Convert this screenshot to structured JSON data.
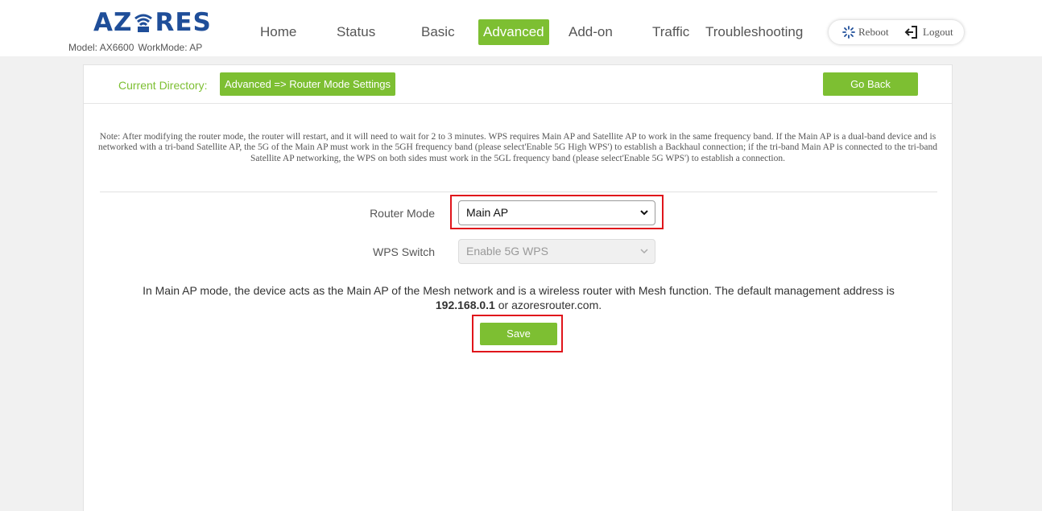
{
  "header": {
    "logo": {
      "part1": "AZ",
      "part2": "RES"
    },
    "model_label": "Model: AX6600",
    "workmode_label": "WorkMode: AP",
    "nav": {
      "home": "Home",
      "status": "Status",
      "basic": "Basic",
      "advanced": "Advanced",
      "addon": "Add-on",
      "traffic": "Traffic",
      "troubleshooting": "Troubleshooting"
    },
    "active_nav": "Advanced",
    "reboot_label": "Reboot",
    "logout_label": "Logout"
  },
  "breadcrumb": {
    "label": "Current Directory:",
    "path": "Advanced => Router Mode Settings",
    "go_back": "Go Back"
  },
  "note": "Note: After modifying the router mode, the router will restart, and it will need to wait for 2 to 3 minutes. WPS requires Main AP and Satellite AP to work in the same frequency band. If the Main AP is a dual-band device and is networked with a tri-band Satellite AP, the 5G of the Main AP must work in the 5GH frequency band (please select'Enable 5G High WPS') to establish a Backhaul connection; if the tri-band Main AP is connected to the tri-band Satellite AP networking, the WPS on both sides must work in the 5GL frequency band (please select'Enable 5G WPS') to establish a connection.",
  "form": {
    "router_mode": {
      "label": "Router Mode",
      "value": "Main AP"
    },
    "wps_switch": {
      "label": "WPS Switch",
      "value": "Enable 5G WPS",
      "disabled": true
    }
  },
  "description": {
    "text": "In Main AP mode, the device acts as the Main AP of the Mesh network and is a wireless router with Mesh function. The default management address is",
    "address": "192.168.0.1",
    "suffix": "or azoresrouter.com."
  },
  "save_label": "Save",
  "colors": {
    "brand_green": "#7dbf32",
    "logo_blue": "#1f4e99",
    "highlight_red": "#e0151b"
  },
  "icons": {
    "reboot": "reboot-spinner-icon",
    "logout": "logout-arrow-icon",
    "select_chevron": "chevron-down-icon",
    "logo_wifi": "wifi-icon"
  }
}
